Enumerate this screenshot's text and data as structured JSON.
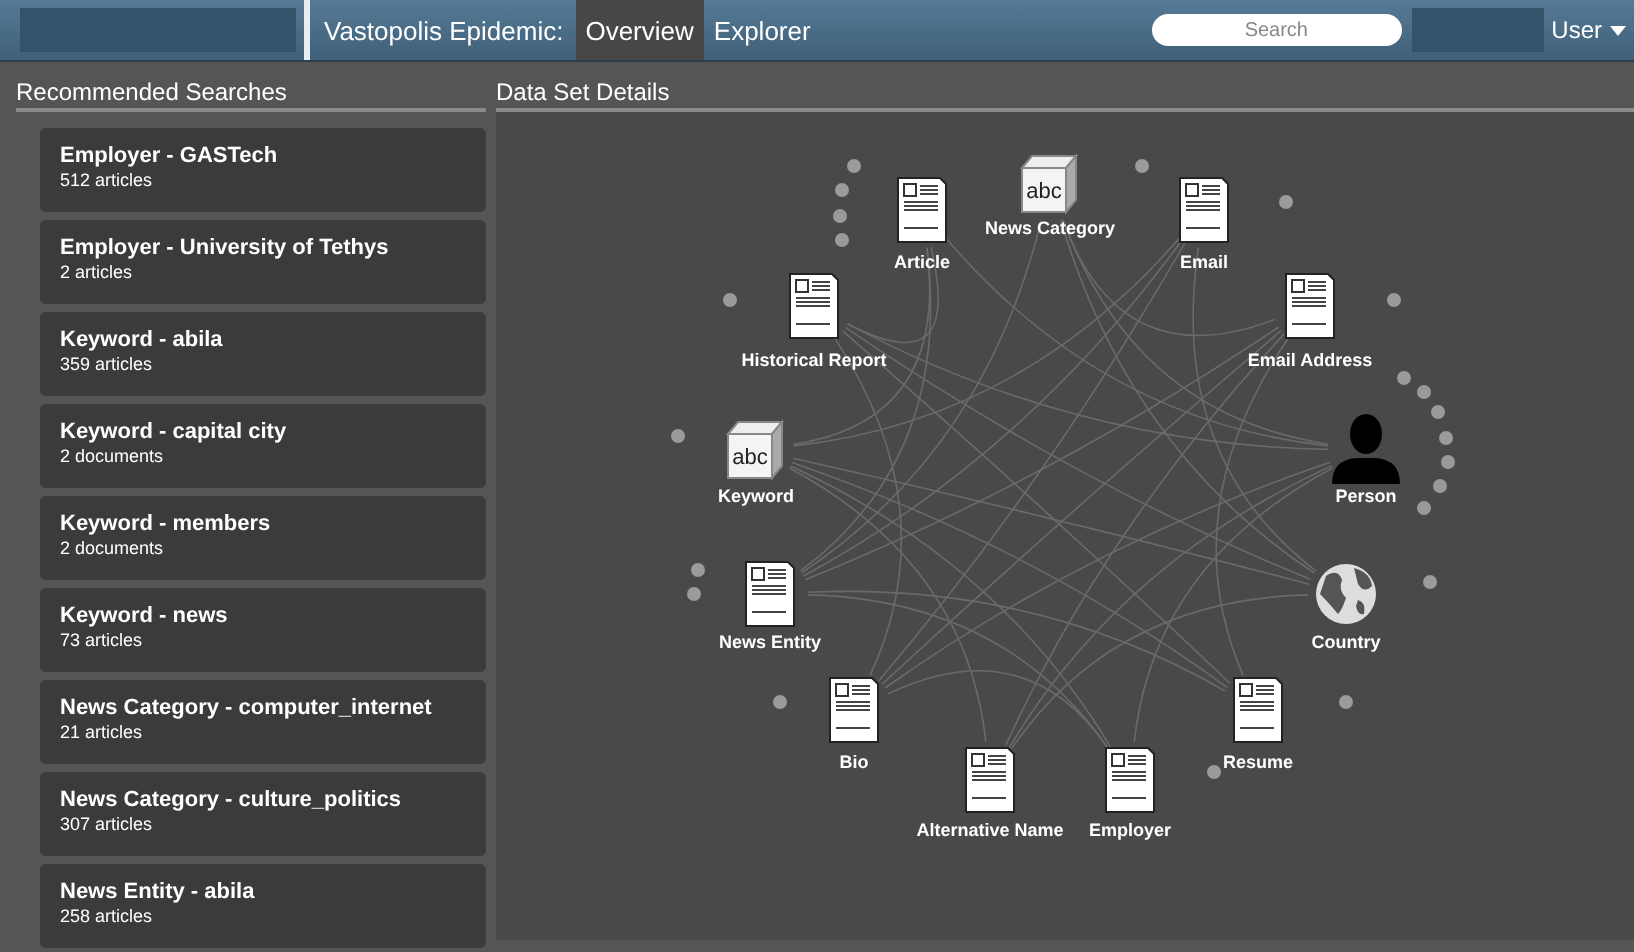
{
  "header": {
    "title": "Vastopolis Epidemic:",
    "tabs": [
      {
        "label": "Overview",
        "selected": true
      },
      {
        "label": "Explorer",
        "selected": false
      }
    ],
    "search": {
      "placeholder": "Search"
    },
    "user_menu": "User"
  },
  "recommended_searches": {
    "heading": "Recommended Searches",
    "items": [
      {
        "title": "Employer - GASTech",
        "count": "512 articles"
      },
      {
        "title": "Employer - University of Tethys",
        "count": "2 articles"
      },
      {
        "title": "Keyword - abila",
        "count": "359 articles"
      },
      {
        "title": "Keyword - capital city",
        "count": "2 documents"
      },
      {
        "title": "Keyword - members",
        "count": "2 documents"
      },
      {
        "title": "Keyword - news",
        "count": "73 articles"
      },
      {
        "title": "News Category - computer_internet",
        "count": "21 articles"
      },
      {
        "title": "News Category - culture_politics",
        "count": "307 articles"
      },
      {
        "title": "News Entity - abila",
        "count": "258 articles"
      }
    ]
  },
  "data_set_details": {
    "heading": "Data Set Details",
    "nodes": [
      {
        "label": "Article",
        "kind": "document"
      },
      {
        "label": "News Category",
        "kind": "cube",
        "icon_text": "abc"
      },
      {
        "label": "Email",
        "kind": "document"
      },
      {
        "label": "Historical Report",
        "kind": "document"
      },
      {
        "label": "Email Address",
        "kind": "document"
      },
      {
        "label": "Keyword",
        "kind": "cube",
        "icon_text": "abc"
      },
      {
        "label": "Person",
        "kind": "person"
      },
      {
        "label": "News Entity",
        "kind": "document"
      },
      {
        "label": "Country",
        "kind": "globe"
      },
      {
        "label": "Bio",
        "kind": "document"
      },
      {
        "label": "Resume",
        "kind": "document"
      },
      {
        "label": "Alternative Name",
        "kind": "document"
      },
      {
        "label": "Employer",
        "kind": "document"
      }
    ]
  }
}
